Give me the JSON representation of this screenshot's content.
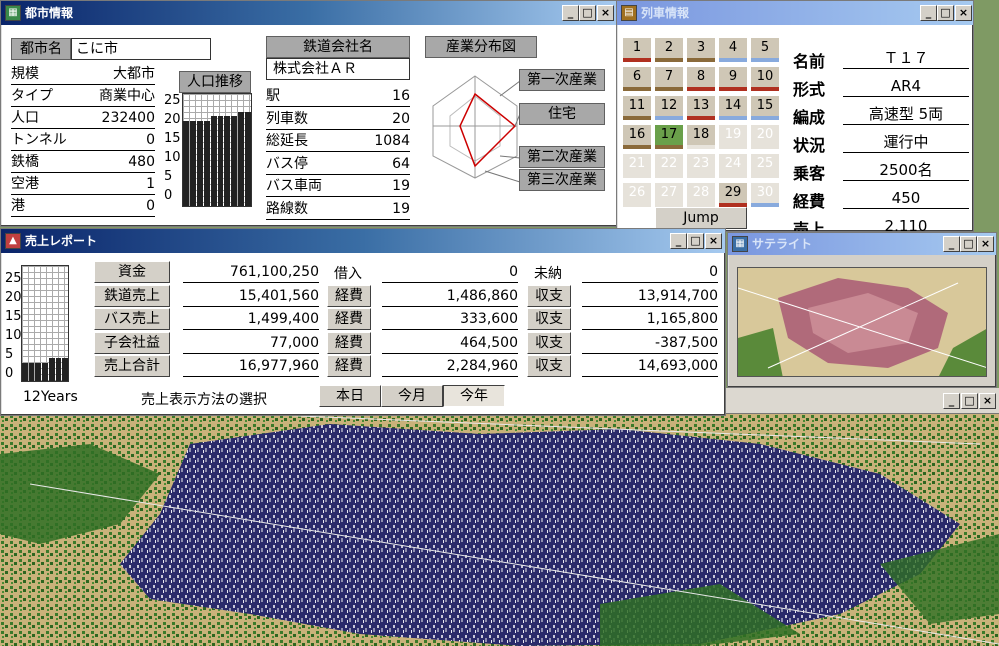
{
  "city_window": {
    "title": "都市情報",
    "city_name_label": "都市名",
    "city_name": "こに市",
    "stats": [
      {
        "label": "規模",
        "value": "大都市"
      },
      {
        "label": "タイプ",
        "value": "商業中心"
      },
      {
        "label": "人口",
        "value": "232400"
      },
      {
        "label": "トンネル",
        "value": "0"
      },
      {
        "label": "鉄橋",
        "value": "480"
      },
      {
        "label": "空港",
        "value": "1"
      },
      {
        "label": "港",
        "value": "0"
      }
    ],
    "population_chart": {
      "title": "人口推移",
      "ticks": [
        "25",
        "20",
        "15",
        "10",
        "5",
        "0"
      ],
      "values": [
        19,
        19,
        19,
        19,
        20,
        20,
        20,
        20,
        21,
        21
      ]
    },
    "company_label": "鉄道会社名",
    "company_name": "株式会社ＡＲ",
    "company_stats": [
      {
        "label": "駅",
        "value": "16"
      },
      {
        "label": "列車数",
        "value": "20"
      },
      {
        "label": "総延長",
        "value": "1084"
      },
      {
        "label": "バス停",
        "value": "64"
      },
      {
        "label": "バス車両",
        "value": "19"
      },
      {
        "label": "路線数",
        "value": "19"
      }
    ],
    "industry_button": "産業分布図",
    "industry_labels": [
      "第一次産業",
      "住宅",
      "第二次産業",
      "第三次産業"
    ]
  },
  "train_window": {
    "title": "列車情報",
    "trains": [
      {
        "n": "1",
        "state": "active",
        "bar": "#b03020"
      },
      {
        "n": "2",
        "state": "active",
        "bar": "#8a6a3a"
      },
      {
        "n": "3",
        "state": "active",
        "bar": "#8a6a3a"
      },
      {
        "n": "4",
        "state": "active",
        "bar": "#88aadd"
      },
      {
        "n": "5",
        "state": "active",
        "bar": "#88aadd"
      },
      {
        "n": "6",
        "state": "active",
        "bar": "#8a6a3a"
      },
      {
        "n": "7",
        "state": "active",
        "bar": "#8a6a3a"
      },
      {
        "n": "8",
        "state": "active",
        "bar": "#b03020"
      },
      {
        "n": "9",
        "state": "active",
        "bar": "#b03020"
      },
      {
        "n": "10",
        "state": "active",
        "bar": "#b03020"
      },
      {
        "n": "11",
        "state": "active",
        "bar": "#8a6a3a"
      },
      {
        "n": "12",
        "state": "active",
        "bar": "#88aadd"
      },
      {
        "n": "13",
        "state": "active",
        "bar": "#b03020"
      },
      {
        "n": "14",
        "state": "active",
        "bar": "#88aadd"
      },
      {
        "n": "15",
        "state": "active",
        "bar": "#88aadd"
      },
      {
        "n": "16",
        "state": "active",
        "bar": "#8a6a3a"
      },
      {
        "n": "17",
        "state": "selected",
        "bar": "#8a6a3a"
      },
      {
        "n": "18",
        "state": "active",
        "bar": "#e8e4dc"
      },
      {
        "n": "19",
        "state": "empty",
        "bar": ""
      },
      {
        "n": "20",
        "state": "empty",
        "bar": ""
      },
      {
        "n": "21",
        "state": "empty",
        "bar": ""
      },
      {
        "n": "22",
        "state": "empty",
        "bar": ""
      },
      {
        "n": "23",
        "state": "empty",
        "bar": ""
      },
      {
        "n": "24",
        "state": "empty",
        "bar": ""
      },
      {
        "n": "25",
        "state": "empty",
        "bar": ""
      },
      {
        "n": "26",
        "state": "empty",
        "bar": ""
      },
      {
        "n": "27",
        "state": "empty",
        "bar": ""
      },
      {
        "n": "28",
        "state": "empty",
        "bar": ""
      },
      {
        "n": "29",
        "state": "active",
        "bar": "#b03020"
      },
      {
        "n": "30",
        "state": "empty",
        "bar": "#88aadd"
      }
    ],
    "jump_label": "Jump",
    "info": [
      {
        "label": "名前",
        "value": "Ｔ１７"
      },
      {
        "label": "形式",
        "value": "AR4"
      },
      {
        "label": "編成",
        "value": "高速型 5両"
      },
      {
        "label": "状況",
        "value": "運行中"
      },
      {
        "label": "乗客",
        "value": "2500名"
      },
      {
        "label": "経費",
        "value": "450"
      },
      {
        "label": "売上",
        "value": "2,110"
      }
    ]
  },
  "sales_window": {
    "title": "売上レポート",
    "chart": {
      "ticks": [
        "25",
        "20",
        "15",
        "10",
        "5",
        "0"
      ],
      "values": [
        4,
        4,
        4,
        4,
        5,
        5,
        5
      ],
      "xlabel": "12Years"
    },
    "rows": [
      {
        "label": "資金",
        "value": "761,100,250",
        "col2_label": "借入",
        "col2_value": "0",
        "col3_label": "未納",
        "col3_value": "0"
      },
      {
        "label": "鉄道売上",
        "value": "15,401,560",
        "col2_label": "経費",
        "col2_value": "1,486,860",
        "col3_label": "収支",
        "col3_value": "13,914,700"
      },
      {
        "label": "バス売上",
        "value": "1,499,400",
        "col2_label": "経費",
        "col2_value": "333,600",
        "col3_label": "収支",
        "col3_value": "1,165,800"
      },
      {
        "label": "子会社益",
        "value": "77,000",
        "col2_label": "経費",
        "col2_value": "464,500",
        "col3_label": "収支",
        "col3_value": "-387,500"
      },
      {
        "label": "売上合計",
        "value": "16,977,960",
        "col2_label": "経費",
        "col2_value": "2,284,960",
        "col3_label": "収支",
        "col3_value": "14,693,000"
      }
    ],
    "method_label": "売上表示方法の選択",
    "tabs": [
      "本日",
      "今月",
      "今年"
    ],
    "active_tab": 2
  },
  "radar_window": {
    "title": "サテライト"
  },
  "controls": {
    "minimize": "_",
    "maximize": "□",
    "close": "×"
  }
}
